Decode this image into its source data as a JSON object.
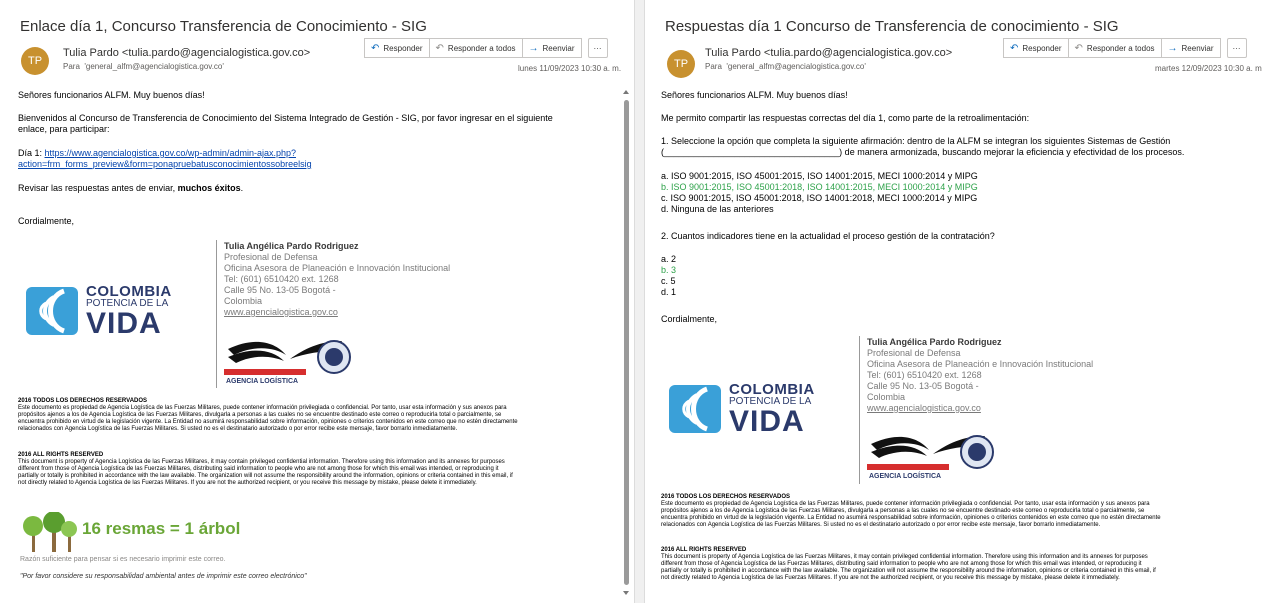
{
  "left": {
    "subject": "Enlace día 1, Concurso Transferencia de Conocimiento - SIG",
    "avatar": "TP",
    "sender": "Tulia Pardo <tulia.pardo@agencialogistica.gov.co>",
    "to_label": "Para",
    "to": "'general_alfm@agencialogistica.gov.co'",
    "date": "lunes 11/09/2023 10:30 a. m.",
    "actions": {
      "reply": "Responder",
      "reply_all": "Responder a todos",
      "forward": "Reenviar",
      "more": "···"
    },
    "greeting": "Señores funcionarios ALFM.   Muy buenos días!",
    "intro_1": "Bienvenidos al Concurso de Transferencia de Conocimiento del Sistema Integrado de Gestión - SIG, por favor ingresar en el siguiente",
    "intro_2": "enlace, para participar:",
    "day_label": "Día 1: ",
    "link_1": "https://www.agencialogistica.gov.co/wp-admin/admin-ajax.php?",
    "link_2": "action=frm_forms_preview&form=ponapruebatusconocimientossobreelsig",
    "review_pre": "Revisar las respuestas antes de enviar, ",
    "review_bold": "muchos éxitos",
    "review_post": ".",
    "closing": "Cordialmente,"
  },
  "right": {
    "subject": "Respuestas día 1 Concurso de Transferencia de conocimiento - SIG",
    "avatar": "TP",
    "sender": "Tulia Pardo <tulia.pardo@agencialogistica.gov.co>",
    "to_label": "Para",
    "to": "'general_alfm@agencialogistica.gov.co'",
    "date": "martes 12/09/2023 10:30 a. m.",
    "actions": {
      "reply": "Responder",
      "reply_all": "Responder a todos",
      "forward": "Reenviar",
      "more": "···"
    },
    "greeting": "Señores funcionarios ALFM.   Muy buenos días!",
    "intro": "Me permito compartir las respuestas correctas del día 1, como parte de la retroalimentación:",
    "q1_a": "1. Seleccione la opción que completa la siguiente afirmación: dentro de la ALFM se integran los siguientes Sistemas de Gestión",
    "q1_b": "(___________________________________) de manera armonizada, buscando mejorar la eficiencia y efectividad de los procesos.",
    "q1_options": [
      "a. ISO 9001:2015, ISO 45001:2015, ISO 14001:2015, MECI 1000:2014 y MIPG",
      "b. ISO 9001:2015, ISO 45001:2018, ISO 14001:2015, MECI 1000:2014 y MIPG",
      "c. ISO 9001:2015, ISO 45001:2018, ISO 14001:2018, MECI 1000:2014 y MIPG",
      "d. Ninguna de las anteriores"
    ],
    "q2": "2. Cuantos indicadores tiene en la actualidad el proceso gestión de la contratación?",
    "q2_options": [
      "a. 2",
      "b. 3",
      "c. 5",
      "d. 1"
    ],
    "closing": "Cordialmente,"
  },
  "signature": {
    "name": "Tulia Angélica Pardo Rodriguez",
    "role": "Profesional de Defensa",
    "office": "Oficina Asesora de Planeación e Innovación Institucional",
    "tel": "Tel: (601) 6510420  ext. 1268",
    "address": "Calle 95 No. 13-05 Bogotá -",
    "country": "Colombia",
    "web": "www.agencialogistica.gov.co"
  },
  "brand": {
    "colombia": "COLOMBIA",
    "potencia": "POTENCIA DE LA",
    "vida": "VIDA",
    "agency_1": "AGENCIA LOGÍSTICA",
    "agency_2": "FUERZAS MILITARES",
    "agency_3": "La unión de nuestras Fuerzas"
  },
  "legal": {
    "es_title": "2016 TODOS LOS DERECHOS RESERVADOS",
    "es_lines": [
      "Este documento es propiedad de Agencia Logística de las Fuerzas Militares, puede contener información privilegiada o confidencial. Por tanto, usar esta información y sus anexos para",
      "propósitos ajenos a los de Agencia Logística de las Fuerzas Militares, divulgarla a personas a las cuales no se encuentre destinado este correo o reproducirla total o parcialmente, se",
      "encuentra prohibido en virtud de la legislación vigente. La Entidad no asumirá responsabilidad sobre información, opiniones o criterios contenidos en este correo que no estén directamente",
      "relacionados con Agencia Logística de las Fuerzas Militares. Si usted no es el destinatario autorizado o por error recibe este mensaje, favor borrarlo inmediatamente."
    ],
    "en_title": "2016 ALL RIGHTS RESERVED",
    "en_lines": [
      "This document is property of Agencia Logística de las Fuerzas Militares, it may contain privileged confidential information. Therefore using this information and its annexes for purposes",
      "different from those of Agencia Logística de las Fuerzas Militares, distributing said information to people who are not among those for which this email was intended, or reproducing it",
      "partially or totally is prohibited in accordance with the law available.  The organization will not assume the responsibility around the information, opinions or criteria contained in this email, if",
      "not directly related to Agencia Logística de las Fuerzas Militares.  If you are not the authorized recipient, or you receive this message by mistake, please delete it immediately."
    ]
  },
  "green_footer": {
    "resmas": "16 resmas = 1 árbol",
    "razon": "Razón suficiente para pensar si es necesario imprimir este correo.",
    "favor": "\"Por favor considere su responsabilidad ambiental antes de imprimir este correo electrónico\""
  },
  "colors": {
    "accent": "#0f6cbd",
    "avatar": "#c8912f",
    "link": "#0645ad",
    "correct": "#2ea24a",
    "brand_navy": "#2b3a6b",
    "brand_cyan": "#3aa0d8"
  }
}
